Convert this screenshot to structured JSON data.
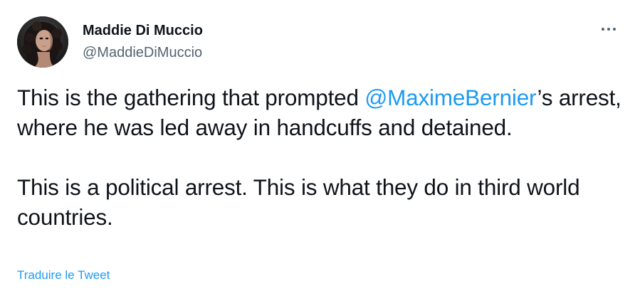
{
  "author": {
    "name": "Maddie Di Muccio",
    "handle": "@MaddieDiMuccio",
    "avatar_icon": "profile-photo-avatar"
  },
  "menu": {
    "icon": "more-horizontal-icon"
  },
  "tweet": {
    "line1_before": "This is the gathering that prompted ",
    "mention": "@MaximeBernier",
    "line1_after": "’s arrest, where he was led away in handcuffs and detained.",
    "paragraph2": "This is a political arrest. This is what they do in third world countries."
  },
  "translate_label": "Traduire le Tweet",
  "colors": {
    "link": "#1d9bf0",
    "secondary_text": "#536471",
    "primary_text": "#0f1419"
  }
}
